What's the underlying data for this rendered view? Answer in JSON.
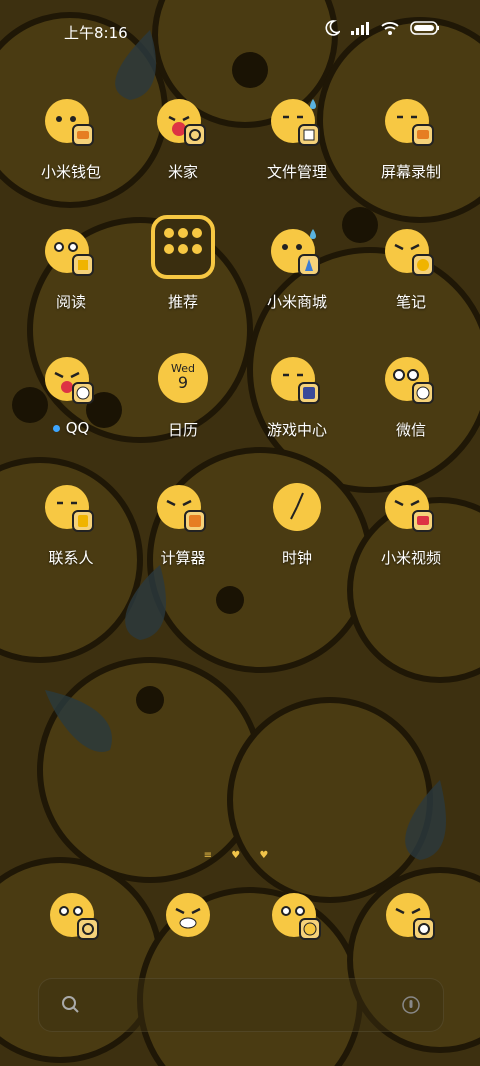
{
  "status": {
    "time": "上午8:16",
    "icons": [
      "moon-icon",
      "signal-icon",
      "wifi-icon",
      "battery-icon"
    ]
  },
  "apps": [
    {
      "label": "小米钱包",
      "icon": "wallet-icon"
    },
    {
      "label": "米家",
      "icon": "home-icon"
    },
    {
      "label": "文件管理",
      "icon": "file-manager-icon"
    },
    {
      "label": "屏幕录制",
      "icon": "screen-record-icon"
    },
    {
      "label": "阅读",
      "icon": "reading-icon"
    },
    {
      "label": "推荐",
      "icon": "folder-icon"
    },
    {
      "label": "小米商城",
      "icon": "store-icon"
    },
    {
      "label": "笔记",
      "icon": "notes-icon"
    },
    {
      "label": "QQ",
      "icon": "qq-icon",
      "has_dot": true
    },
    {
      "label": "日历",
      "icon": "calendar-icon"
    },
    {
      "label": "游戏中心",
      "icon": "game-center-icon"
    },
    {
      "label": "微信",
      "icon": "wechat-icon"
    },
    {
      "label": "联系人",
      "icon": "contacts-icon"
    },
    {
      "label": "计算器",
      "icon": "calculator-icon"
    },
    {
      "label": "时钟",
      "icon": "clock-icon"
    },
    {
      "label": "小米视频",
      "icon": "video-icon"
    }
  ],
  "calendar": {
    "weekday": "Wed",
    "day": "9"
  },
  "dock": [
    {
      "icon": "phone-icon"
    },
    {
      "icon": "messages-icon"
    },
    {
      "icon": "browser-icon"
    },
    {
      "icon": "camera-icon"
    }
  ],
  "colors": {
    "emoji_yellow": "#f7c843",
    "wallpaper": "#3d3010",
    "accent_dot": "#3ea6ff"
  }
}
